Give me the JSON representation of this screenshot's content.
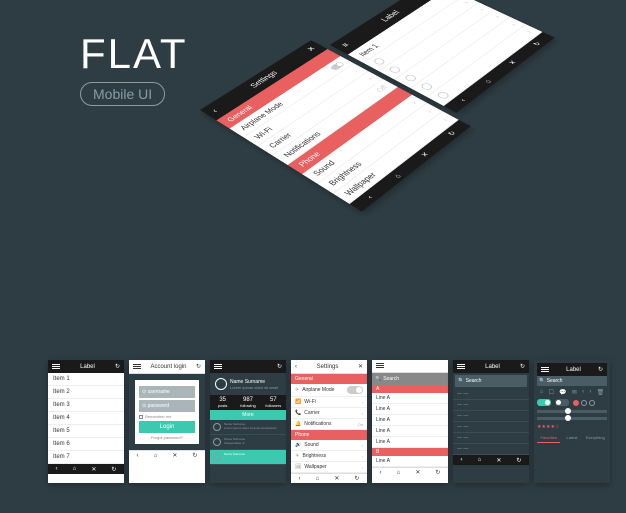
{
  "hero": {
    "title": "FLAT",
    "subtitle": "Mobile UI"
  },
  "iso_settings": {
    "header": "Settings",
    "sec_general": "General",
    "rows_general": [
      {
        "label": "Airplane Mode",
        "kind": "toggle"
      },
      {
        "label": "Wi-Fi",
        "kind": "chev"
      },
      {
        "label": "Carrier",
        "kind": "chev"
      },
      {
        "label": "Notifications",
        "value": "Off"
      }
    ],
    "sec_phone": "Phone",
    "rows_phone": [
      {
        "label": "Sound",
        "kind": "chev"
      },
      {
        "label": "Brightness",
        "kind": "chev"
      },
      {
        "label": "Wallpaper",
        "kind": "chev"
      }
    ]
  },
  "iso_label": {
    "header": "Label",
    "item": "Item 1",
    "rows": [
      "",
      "",
      "",
      "",
      ""
    ]
  },
  "screens": {
    "s1": {
      "header": "Label",
      "items": [
        "Item 1",
        "Item 2",
        "Item 3",
        "Item 4",
        "Item 5",
        "Item 6",
        "Item 7"
      ]
    },
    "s2": {
      "header": "Account login",
      "username_ph": "username",
      "password_ph": "password",
      "remember": "Remember me",
      "login": "Login",
      "forgot": "Forgot password?"
    },
    "s3": {
      "name": "Name Surname",
      "desc": "Lorem ipsum dolor sit amet",
      "stats": [
        {
          "n": "35",
          "l": "posts"
        },
        {
          "n": "987",
          "l": "following"
        },
        {
          "n": "57",
          "l": "followers"
        }
      ],
      "more": "More",
      "comments": [
        {
          "u": "Name Surname",
          "t": "Lorem ipsum dolor sit amet consectetur"
        },
        {
          "u": "Name Surname",
          "t": "Suspendisse ut"
        },
        {
          "u": "Name Surname",
          "t": ""
        }
      ]
    },
    "s4": {
      "header": "Settings",
      "sec_general": "General",
      "rows_g": [
        {
          "label": "Airplane Mode"
        },
        {
          "label": "Wi-Fi"
        },
        {
          "label": "Carrier"
        },
        {
          "label": "Notifications",
          "value": "On"
        }
      ],
      "sec_phone": "Phone",
      "rows_p": [
        {
          "label": "Sound"
        },
        {
          "label": "Brightness"
        },
        {
          "label": "Wallpaper"
        }
      ]
    },
    "s5": {
      "search_ph": "Search",
      "letter_a": "A",
      "lines_a": [
        "Line A",
        "Line A",
        "Line A",
        "Line A",
        "Line A"
      ],
      "letter_b": "B",
      "lines_b": [
        "Line A"
      ]
    },
    "s6": {
      "header": "Label",
      "search_ph": "Search",
      "rows": [
        "",
        "",
        "",
        "",
        "",
        ""
      ]
    },
    "s7": {
      "header": "Label",
      "search_ph": "Search",
      "tabs": [
        "Favorites",
        "Latest",
        "Everything"
      ]
    }
  }
}
